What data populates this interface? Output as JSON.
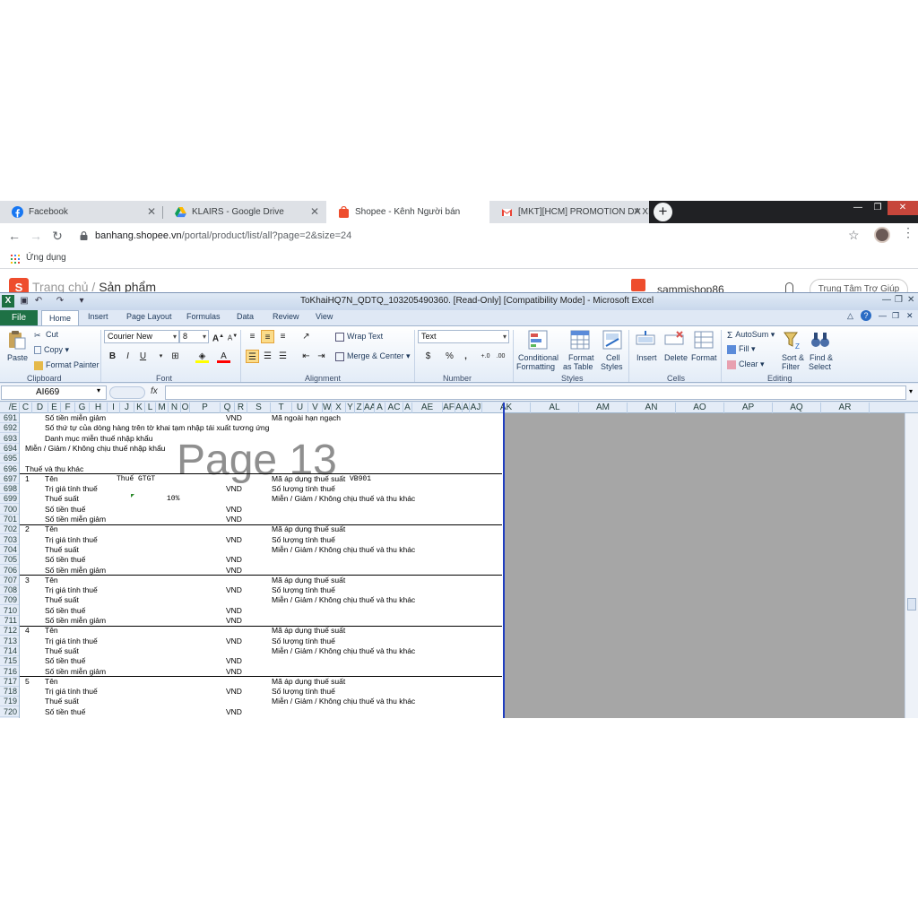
{
  "browser": {
    "tabs": [
      {
        "title": "Facebook",
        "favicon": "facebook-icon"
      },
      {
        "title": "KLAIRS - Google Drive",
        "favicon": "google-drive-icon"
      },
      {
        "title": "Shopee - Kênh Người bán",
        "favicon": "shopee-icon"
      },
      {
        "title": "[MKT][HCM] PROMOTION DA XI",
        "favicon": "gmail-icon"
      }
    ],
    "new_tab_label": "+",
    "url_host": "banhang.shopee.vn",
    "url_path": "/portal/product/list/all?page=2&size=24",
    "bookmark_label": "Ứng dụng"
  },
  "webpage": {
    "breadcrumb_home": "Trang chủ",
    "breadcrumb_sep": "/",
    "breadcrumb_current": "Sản phẩm",
    "shop_name": "sammishop86",
    "help_label": "Trung Tâm Trợ Giúp"
  },
  "excel": {
    "title": "ToKhaiHQ7N_QDTQ_103205490360.  [Read-Only]  [Compatibility Mode]  -  Microsoft Excel",
    "tabs": [
      "File",
      "Home",
      "Insert",
      "Page Layout",
      "Formulas",
      "Data",
      "Review",
      "View"
    ],
    "clipboard": {
      "paste": "Paste",
      "cut": "Cut",
      "copy": "Copy",
      "format_painter": "Format Painter",
      "label": "Clipboard"
    },
    "font": {
      "name": "Courier New",
      "size": "8",
      "label": "Font",
      "bold": "B",
      "italic": "I",
      "underline": "U"
    },
    "alignment": {
      "wrap": "Wrap Text",
      "merge": "Merge & Center",
      "label": "Alignment"
    },
    "number": {
      "format": "Text",
      "currency": "$",
      "percent": "%",
      "comma": ",",
      "label": "Number"
    },
    "styles": {
      "conditional_1": "Conditional",
      "conditional_2": "Formatting",
      "table_1": "Format",
      "table_2": "as Table",
      "cell_1": "Cell",
      "cell_2": "Styles",
      "label": "Styles"
    },
    "cells": {
      "insert": "Insert",
      "delete": "Delete",
      "format": "Format",
      "label": "Cells"
    },
    "editing": {
      "autosum": "AutoSum",
      "fill": "Fill",
      "clear": "Clear",
      "sort_1": "Sort &",
      "sort_2": "Filter",
      "find_1": "Find &",
      "find_2": "Select",
      "label": "Editing"
    },
    "name_box": "AI669",
    "fx": "fx",
    "columns": [
      "/E",
      "C",
      "D",
      "E",
      "F",
      "G",
      "H",
      "I",
      "J",
      "K",
      "L",
      "M",
      "N",
      "O",
      "P",
      "Q",
      "R",
      "S",
      "T",
      "U",
      "V",
      "W",
      "X",
      "Y",
      "Z",
      "AA",
      "A",
      "AC",
      "A",
      "AE",
      "AF",
      "A",
      "A",
      "AJ",
      "AK",
      "AL",
      "AM",
      "AN",
      "AO",
      "AP",
      "AQ",
      "AR"
    ],
    "watermark": "Page 13",
    "rows": [
      {
        "n": "691",
        "a": "",
        "b": "Số tiền miễn giảm",
        "vnd": "VND",
        "c": "Mã ngoài hạn ngạch",
        "d": ""
      },
      {
        "n": "692",
        "a": "",
        "b": "Số thứ tự của dòng hàng trên tờ khai tạm nhập tái xuất tương ứng",
        "vnd": "",
        "c": "",
        "d": ""
      },
      {
        "n": "693",
        "a": "",
        "b": "Danh mục miễn thuế nhập khẩu",
        "vnd": "",
        "c": "",
        "d": ""
      },
      {
        "n": "694",
        "a": "Miễn / Giảm / Không chịu thuế nhập khẩu",
        "b": "",
        "vnd": "",
        "c": "",
        "d": ""
      },
      {
        "n": "695",
        "a": "",
        "b": "",
        "vnd": "",
        "c": "",
        "d": ""
      },
      {
        "n": "696",
        "a": "Thuế và thu khác",
        "b": "",
        "vnd": "",
        "c": "",
        "d": ""
      },
      {
        "n": "697",
        "a": "1",
        "b": "Tên",
        "vnd": "",
        "c": "Mã áp dụng thuế suất",
        "d": "VB901"
      },
      {
        "n": "698",
        "a": "",
        "b": "Trị giá tính thuế",
        "vnd": "VND",
        "c": "Số lượng tính thuế",
        "d": ""
      },
      {
        "n": "699",
        "a": "",
        "b": "Thuế suất",
        "vnd": "",
        "c": "Miễn / Giảm / Không chịu thuế và thu khác",
        "d": ""
      },
      {
        "n": "700",
        "a": "",
        "b": "Số tiền thuế",
        "vnd": "VND",
        "c": "",
        "d": ""
      },
      {
        "n": "701",
        "a": "",
        "b": "Số tiền miễn giảm",
        "vnd": "VND",
        "c": "",
        "d": ""
      },
      {
        "n": "702",
        "a": "2",
        "b": "Tên",
        "vnd": "",
        "c": "Mã áp dụng thuế suất",
        "d": ""
      },
      {
        "n": "703",
        "a": "",
        "b": "Trị giá tính thuế",
        "vnd": "VND",
        "c": "Số lượng tính thuế",
        "d": ""
      },
      {
        "n": "704",
        "a": "",
        "b": "Thuế suất",
        "vnd": "",
        "c": "Miễn / Giảm / Không chịu thuế và thu khác",
        "d": ""
      },
      {
        "n": "705",
        "a": "",
        "b": "Số tiền thuế",
        "vnd": "VND",
        "c": "",
        "d": ""
      },
      {
        "n": "706",
        "a": "",
        "b": "Số tiền miễn giảm",
        "vnd": "VND",
        "c": "",
        "d": ""
      },
      {
        "n": "707",
        "a": "3",
        "b": "Tên",
        "vnd": "",
        "c": "Mã áp dụng thuế suất",
        "d": ""
      },
      {
        "n": "708",
        "a": "",
        "b": "Trị giá tính thuế",
        "vnd": "VND",
        "c": "Số lượng tính thuế",
        "d": ""
      },
      {
        "n": "709",
        "a": "",
        "b": "Thuế suất",
        "vnd": "",
        "c": "Miễn / Giảm / Không chịu thuế và thu khác",
        "d": ""
      },
      {
        "n": "710",
        "a": "",
        "b": "Số tiền thuế",
        "vnd": "VND",
        "c": "",
        "d": ""
      },
      {
        "n": "711",
        "a": "",
        "b": "Số tiền miễn giảm",
        "vnd": "VND",
        "c": "",
        "d": ""
      },
      {
        "n": "712",
        "a": "4",
        "b": "Tên",
        "vnd": "",
        "c": "Mã áp dụng thuế suất",
        "d": ""
      },
      {
        "n": "713",
        "a": "",
        "b": "Trị giá tính thuế",
        "vnd": "VND",
        "c": "Số lượng tính thuế",
        "d": ""
      },
      {
        "n": "714",
        "a": "",
        "b": "Thuế suất",
        "vnd": "",
        "c": "Miễn / Giảm / Không chịu thuế và thu khác",
        "d": ""
      },
      {
        "n": "715",
        "a": "",
        "b": "Số tiền thuế",
        "vnd": "VND",
        "c": "",
        "d": ""
      },
      {
        "n": "716",
        "a": "",
        "b": "Số tiền miễn giảm",
        "vnd": "VND",
        "c": "",
        "d": ""
      },
      {
        "n": "717",
        "a": "5",
        "b": "Tên",
        "vnd": "",
        "c": "Mã áp dụng thuế suất",
        "d": ""
      },
      {
        "n": "718",
        "a": "",
        "b": "Trị giá tính thuế",
        "vnd": "VND",
        "c": "Số lượng tính thuế",
        "d": ""
      },
      {
        "n": "719",
        "a": "",
        "b": "Thuế suất",
        "vnd": "",
        "c": "Miễn / Giảm / Không chịu thuế và thu khác",
        "d": ""
      },
      {
        "n": "720",
        "a": "",
        "b": "Số tiền thuế",
        "vnd": "VND",
        "c": "",
        "d": ""
      }
    ],
    "row697_tax_name": "Thuế GTGT",
    "row699_rate": "10%"
  },
  "colors": {
    "excel_green": "#1e7145",
    "shopee_orange": "#ee4d2d",
    "page_break": "#1f3dbf",
    "chrome_dark": "#202124"
  }
}
